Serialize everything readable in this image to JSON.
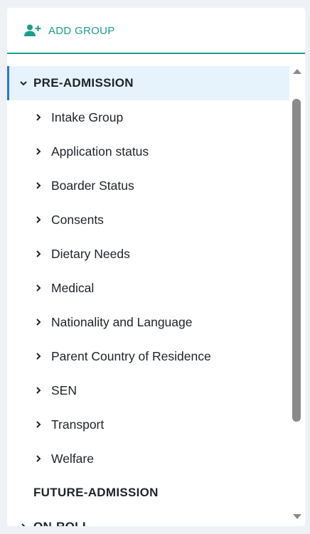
{
  "header": {
    "add_group_label": "ADD GROUP",
    "icon": "add-user-icon"
  },
  "colors": {
    "accent": "#1a9e8a",
    "selected_bg": "#e6f3fd",
    "selected_bar": "#1f7ad6",
    "text": "#1f2328",
    "scroll_thumb": "#8a8a8a"
  },
  "tree": {
    "groups": [
      {
        "label": "PRE-ADMISSION",
        "expanded": true,
        "selected": true,
        "children": [
          {
            "label": "Intake Group"
          },
          {
            "label": "Application status"
          },
          {
            "label": "Boarder Status"
          },
          {
            "label": "Consents"
          },
          {
            "label": "Dietary Needs"
          },
          {
            "label": "Medical"
          },
          {
            "label": "Nationality and Language"
          },
          {
            "label": "Parent Country of Residence"
          },
          {
            "label": "SEN"
          },
          {
            "label": "Transport"
          },
          {
            "label": "Welfare"
          }
        ]
      },
      {
        "label": "FUTURE-ADMISSION",
        "has_children": false
      },
      {
        "label": "ON-ROLL",
        "has_children": true
      }
    ]
  }
}
